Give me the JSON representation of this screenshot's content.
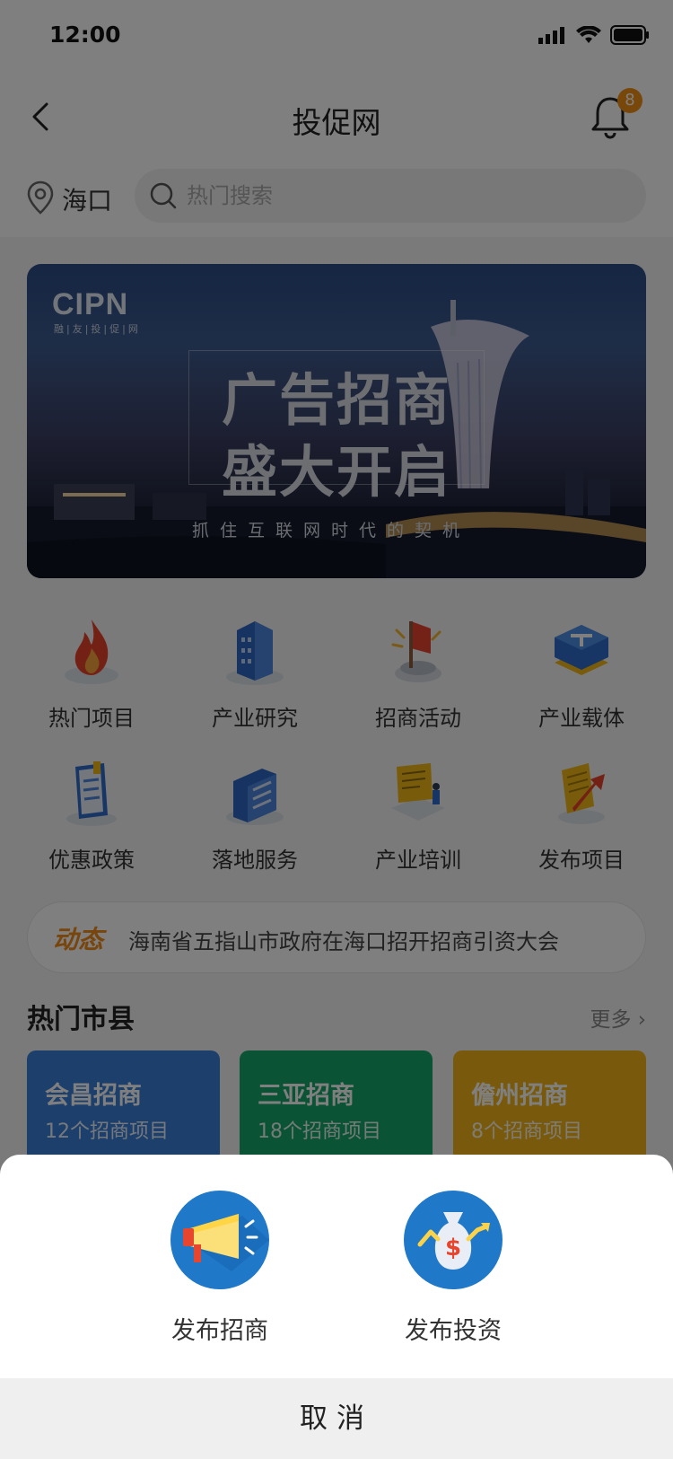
{
  "status_bar": {
    "time": "12:00"
  },
  "header": {
    "title": "投促网",
    "notification_count": "8"
  },
  "location": {
    "city": "海口"
  },
  "search": {
    "placeholder": "热门搜索"
  },
  "banner": {
    "logo": "CIPN",
    "logo_sub": "融|友|投|促|网",
    "title_line1": "广告招商",
    "title_line2": "盛大开启",
    "subtitle": "抓住互联网时代的契机"
  },
  "menu": {
    "items": [
      {
        "label": "热门项目",
        "icon": "fire-icon"
      },
      {
        "label": "产业研究",
        "icon": "building-icon"
      },
      {
        "label": "招商活动",
        "icon": "flag-icon"
      },
      {
        "label": "产业载体",
        "icon": "layers-icon"
      },
      {
        "label": "优惠政策",
        "icon": "document-icon"
      },
      {
        "label": "落地服务",
        "icon": "office-icon"
      },
      {
        "label": "产业培训",
        "icon": "training-icon"
      },
      {
        "label": "发布项目",
        "icon": "publish-icon"
      }
    ]
  },
  "ticker": {
    "tag": "动态",
    "text": "海南省五指山市政府在海口招开招商引资大会"
  },
  "hot_cities": {
    "title": "热门市县",
    "more": "更多",
    "cards": [
      {
        "name": "会昌招商",
        "count": "12个招商项目",
        "color": "#3a7ed8"
      },
      {
        "name": "三亚招商",
        "count": "18个招商项目",
        "color": "#17a76a"
      },
      {
        "name": "儋州招商",
        "count": "8个招商项目",
        "color": "#f2b418"
      }
    ]
  },
  "sheet": {
    "options": [
      {
        "label": "发布招商",
        "icon": "megaphone-icon"
      },
      {
        "label": "发布投资",
        "icon": "money-bag-icon"
      }
    ],
    "cancel": "取消"
  },
  "colors": {
    "accent_orange": "#f08f14",
    "sheet_icon_blue": "#1f78c8"
  }
}
